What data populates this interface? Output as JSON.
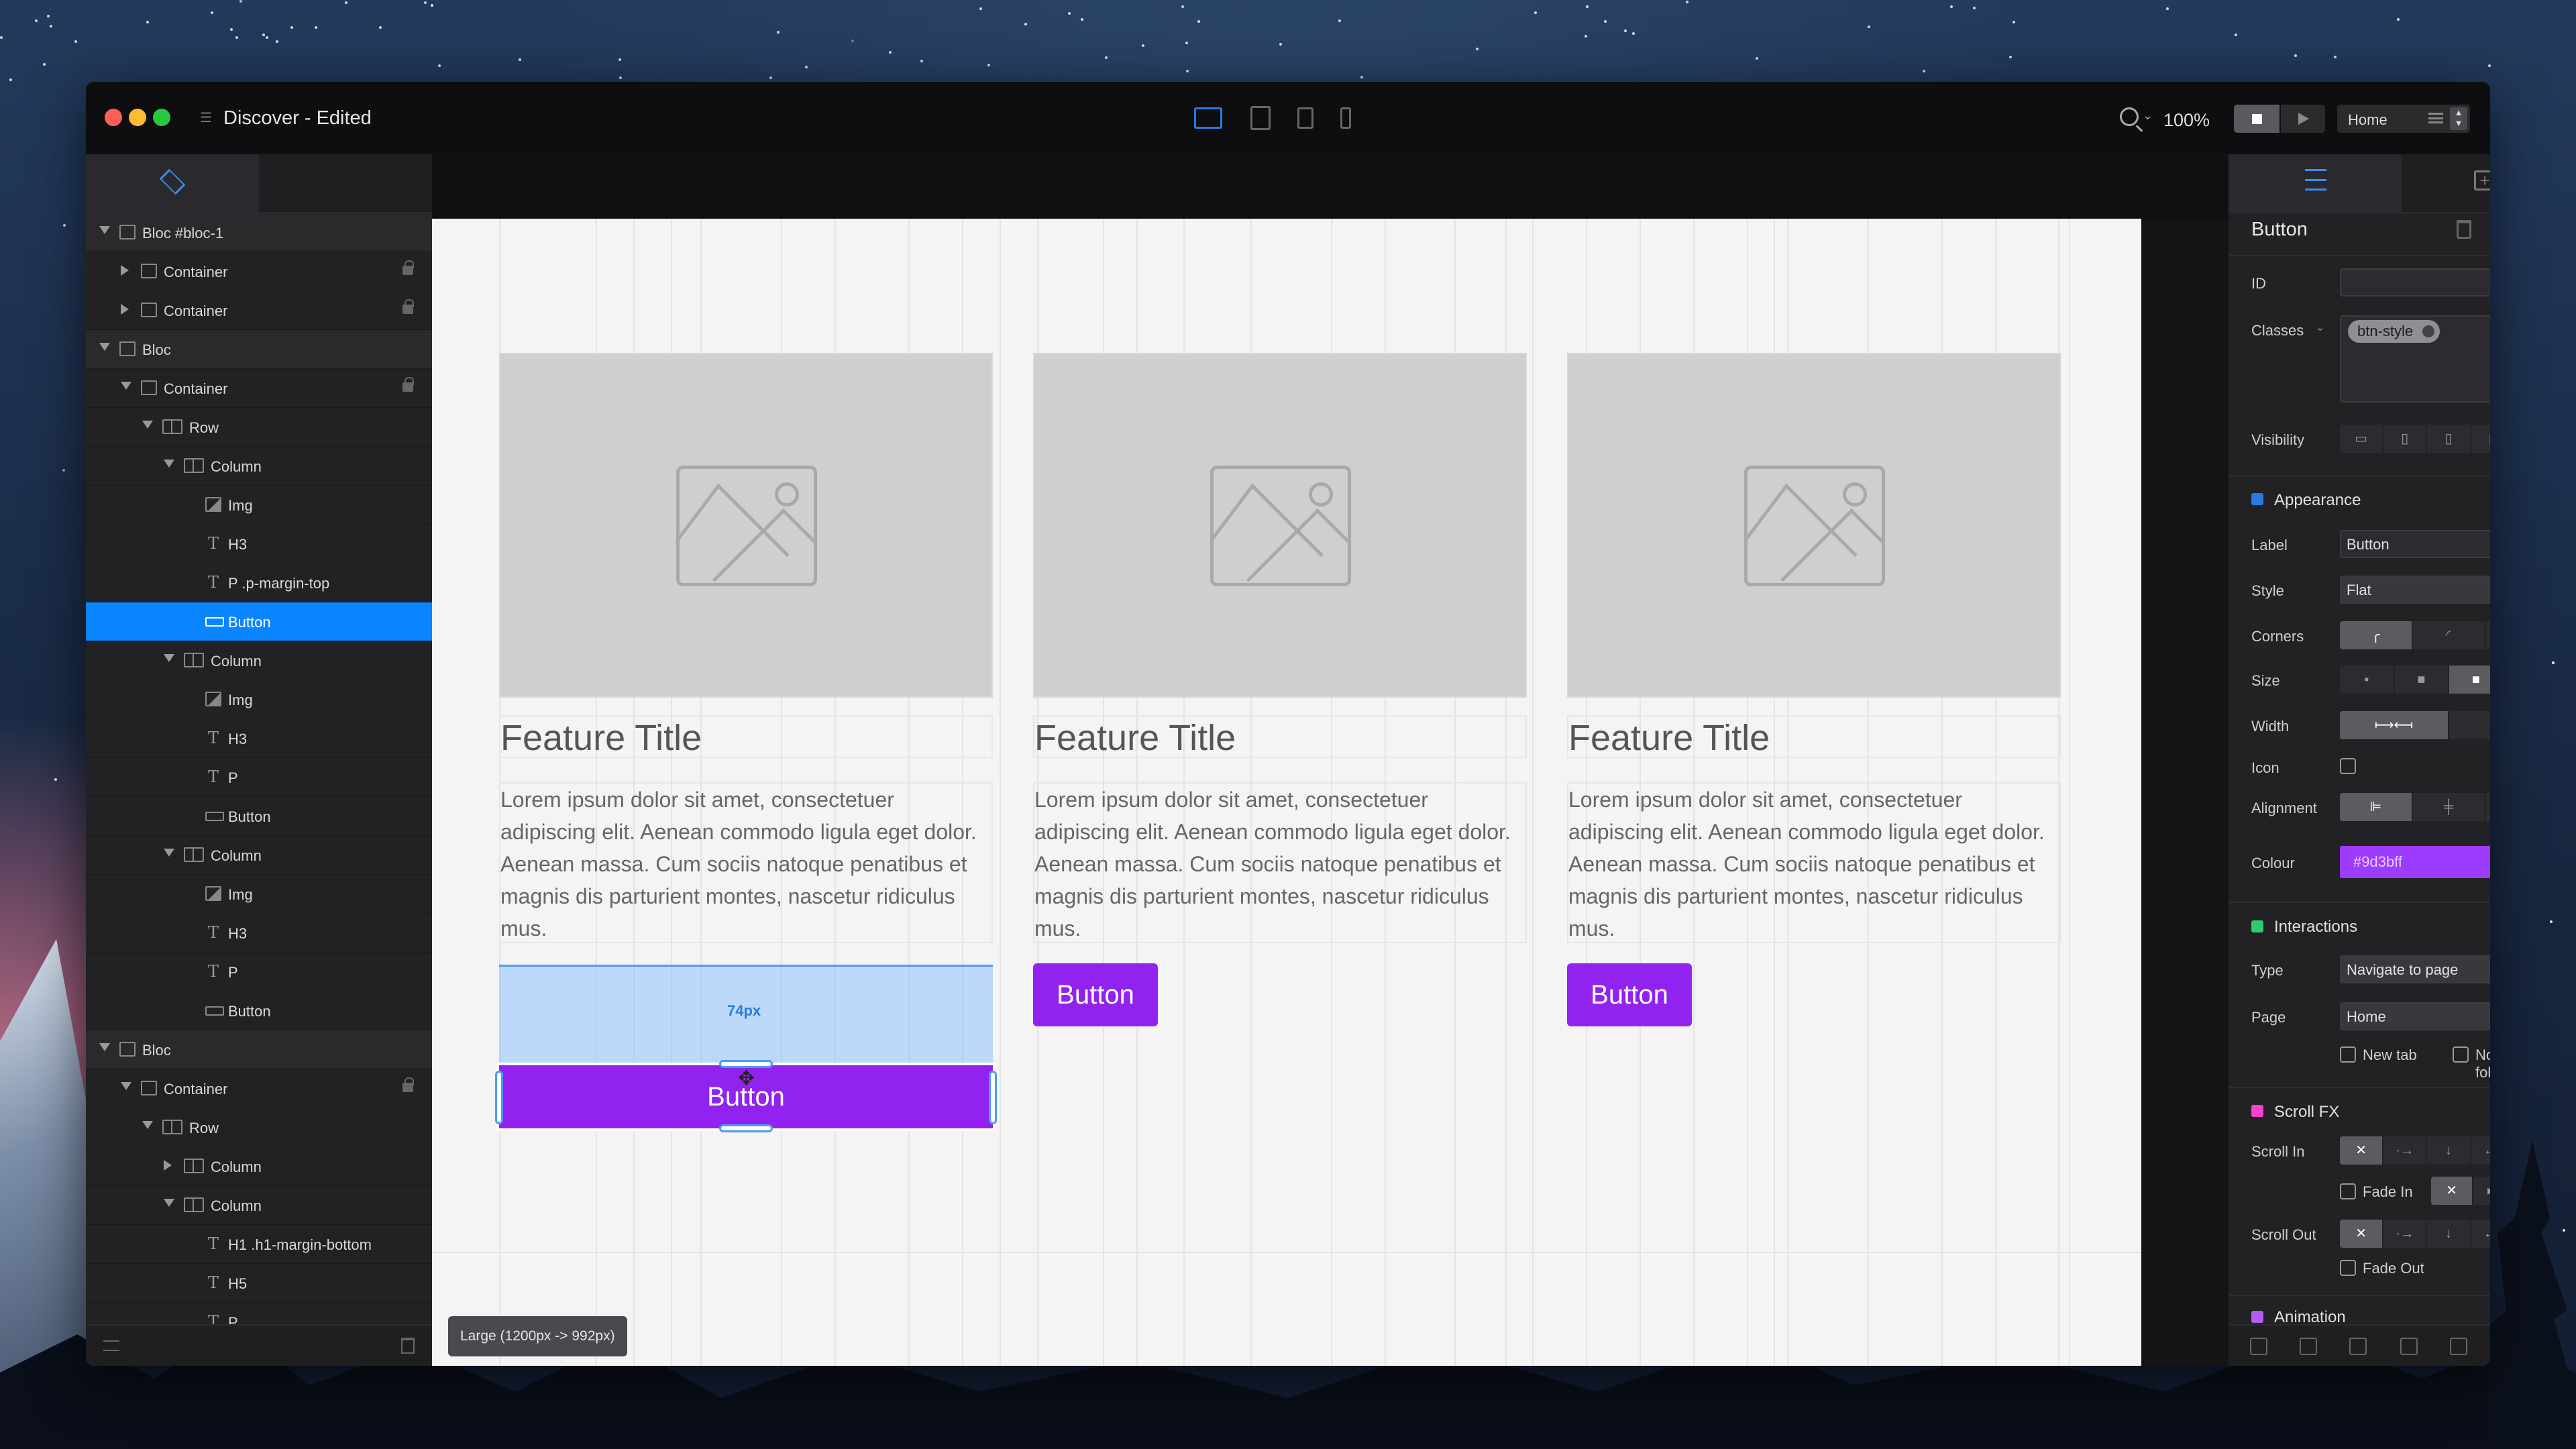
{
  "window": {
    "title": "Discover - Edited",
    "zoom": "100%",
    "page_selector": "Home"
  },
  "layers": [
    {
      "type": "bloc",
      "depth": 0,
      "icon": "box",
      "label": "Bloc #bloc-1",
      "expanded": true
    },
    {
      "type": "item",
      "depth": 1,
      "icon": "container",
      "label": "Container",
      "collapsed": true,
      "lock": true
    },
    {
      "type": "item",
      "depth": 1,
      "icon": "container",
      "label": "Container",
      "collapsed": true,
      "lock": true
    },
    {
      "type": "bloc",
      "depth": 0,
      "icon": "box",
      "label": "Bloc",
      "expanded": true
    },
    {
      "type": "item",
      "depth": 1,
      "icon": "container",
      "label": "Container",
      "expanded": true,
      "lock": true
    },
    {
      "type": "item",
      "depth": 2,
      "icon": "column",
      "label": "Row",
      "expanded": true
    },
    {
      "type": "item",
      "depth": 3,
      "icon": "column",
      "label": "Column",
      "expanded": true
    },
    {
      "type": "item",
      "depth": 4,
      "icon": "img",
      "label": "Img"
    },
    {
      "type": "item",
      "depth": 4,
      "icon": "text",
      "label": "H3"
    },
    {
      "type": "item",
      "depth": 4,
      "icon": "text",
      "label": "P .p-margin-top"
    },
    {
      "type": "item",
      "depth": 4,
      "icon": "button",
      "label": "Button",
      "selected": true
    },
    {
      "type": "item",
      "depth": 3,
      "icon": "column",
      "label": "Column",
      "expanded": true
    },
    {
      "type": "item",
      "depth": 4,
      "icon": "img",
      "label": "Img"
    },
    {
      "type": "item",
      "depth": 4,
      "icon": "text",
      "label": "H3"
    },
    {
      "type": "item",
      "depth": 4,
      "icon": "text",
      "label": "P"
    },
    {
      "type": "item",
      "depth": 4,
      "icon": "button",
      "label": "Button"
    },
    {
      "type": "item",
      "depth": 3,
      "icon": "column",
      "label": "Column",
      "expanded": true
    },
    {
      "type": "item",
      "depth": 4,
      "icon": "img",
      "label": "Img"
    },
    {
      "type": "item",
      "depth": 4,
      "icon": "text",
      "label": "H3"
    },
    {
      "type": "item",
      "depth": 4,
      "icon": "text",
      "label": "P"
    },
    {
      "type": "item",
      "depth": 4,
      "icon": "button",
      "label": "Button"
    },
    {
      "type": "bloc",
      "depth": 0,
      "icon": "box",
      "label": "Bloc",
      "expanded": true
    },
    {
      "type": "item",
      "depth": 1,
      "icon": "container",
      "label": "Container",
      "expanded": true,
      "lock": true
    },
    {
      "type": "item",
      "depth": 2,
      "icon": "column",
      "label": "Row",
      "expanded": true
    },
    {
      "type": "item",
      "depth": 3,
      "icon": "column",
      "label": "Column",
      "collapsed": true
    },
    {
      "type": "item",
      "depth": 3,
      "icon": "column",
      "label": "Column",
      "expanded": true
    },
    {
      "type": "item",
      "depth": 4,
      "icon": "text",
      "label": "H1 .h1-margin-bottom"
    },
    {
      "type": "item",
      "depth": 4,
      "icon": "text",
      "label": "H5"
    },
    {
      "type": "item",
      "depth": 4,
      "icon": "text",
      "label": "P"
    }
  ],
  "canvas": {
    "cards": [
      {
        "title": "Feature Title",
        "text": "Lorem ipsum dolor sit amet, consectetuer adipiscing elit. Aenean commodo ligula eget dolor. Aenean massa. Cum sociis natoque penatibus et magnis dis parturient montes, nascetur ridiculus mus.",
        "button": "Button"
      },
      {
        "title": "Feature Title",
        "text": "Lorem ipsum dolor sit amet, consectetuer adipiscing elit. Aenean commodo ligula eget dolor. Aenean massa. Cum sociis natoque penatibus et magnis dis parturient montes, nascetur ridiculus mus.",
        "button": "Button"
      },
      {
        "title": "Feature Title",
        "text": "Lorem ipsum dolor sit amet, consectetuer adipiscing elit. Aenean commodo ligula eget dolor. Aenean massa. Cum sociis natoque penatibus et magnis dis parturient montes, nascetur ridiculus mus.",
        "button": "Button"
      }
    ],
    "margin_label": "74px",
    "breakpoint": "Large (1200px -> 992px)"
  },
  "inspector": {
    "title": "Button",
    "id_label": "ID",
    "id_value": "",
    "classes_label": "Classes",
    "class_chip": "btn-style",
    "visibility_label": "Visibility",
    "appearance": {
      "section": "Appearance",
      "color": "#2a7ae2",
      "label_label": "Label",
      "label_value": "Button",
      "style_label": "Style",
      "style_value": "Flat",
      "corners_label": "Corners",
      "size_label": "Size",
      "width_label": "Width",
      "icon_label": "Icon",
      "alignment_label": "Alignment",
      "colour_label": "Colour",
      "colour_value": "#9d3bff"
    },
    "interactions": {
      "section": "Interactions",
      "color": "#2ecc71",
      "type_label": "Type",
      "type_value": "Navigate to page",
      "page_label": "Page",
      "page_value": "Home",
      "new_tab": "New tab",
      "no_follow": "No follow"
    },
    "scrollfx": {
      "section": "Scroll FX",
      "color": "#ff3fd0",
      "scroll_in": "Scroll In",
      "fade_in": "Fade In",
      "scroll_out": "Scroll Out",
      "fade_out": "Fade Out"
    },
    "animation": {
      "section": "Animation",
      "color": "#b45cf0"
    }
  }
}
